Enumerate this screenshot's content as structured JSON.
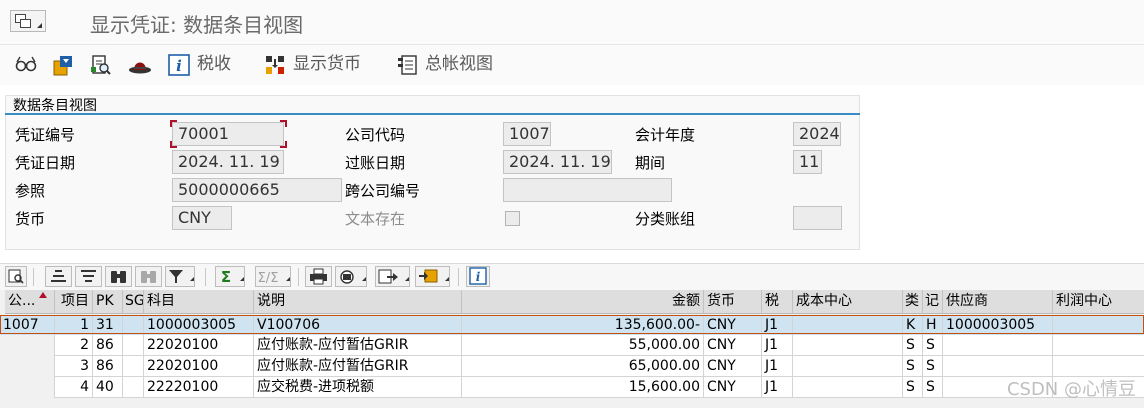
{
  "title": "显示凭证: 数据条目视图",
  "toolbar": {
    "tax_label": "税收",
    "display_currency_label": "显示货币",
    "gl_view_label": "总帐视图"
  },
  "panel": {
    "title": "数据条目视图",
    "doc_no_label": "凭证编号",
    "doc_no": "70001",
    "company_label": "公司代码",
    "company": "1007",
    "fiscal_year_label": "会计年度",
    "fiscal_year": "2024",
    "doc_date_label": "凭证日期",
    "doc_date": "2024. 11. 19",
    "posting_date_label": "过账日期",
    "posting_date": "2024. 11. 19",
    "period_label": "期间",
    "period": "11",
    "reference_label": "参照",
    "reference": "5000000665",
    "cross_company_label": "跨公司编号",
    "cross_company": "",
    "currency_label": "货币",
    "currency": "CNY",
    "text_exists_label": "文本存在",
    "ledger_group_label": "分类账组",
    "ledger_group": ""
  },
  "grid": {
    "headers": {
      "company": "公...",
      "item": "项目",
      "pk": "PK",
      "sg": "SG",
      "account": "科目",
      "desc": "说明",
      "amount": "金额",
      "currency": "货币",
      "tax": "税",
      "cost_center": "成本中心",
      "type": "类",
      "rec": "记",
      "vendor": "供应商",
      "profit_center": "利润中心"
    },
    "rows": [
      {
        "company": "1007",
        "item": "1",
        "pk": "31",
        "sg": "",
        "account": "1000003005",
        "desc": "V100706",
        "amount": "135,600.00-",
        "currency": "CNY",
        "tax": "J1",
        "cost_center": "",
        "type": "K",
        "rec": "H",
        "vendor": "1000003005",
        "profit_center": ""
      },
      {
        "company": "",
        "item": "2",
        "pk": "86",
        "sg": "",
        "account": "22020100",
        "desc": "应付账款-应付暂估GRIR",
        "amount": "55,000.00",
        "currency": "CNY",
        "tax": "J1",
        "cost_center": "",
        "type": "S",
        "rec": "S",
        "vendor": "",
        "profit_center": ""
      },
      {
        "company": "",
        "item": "3",
        "pk": "86",
        "sg": "",
        "account": "22020100",
        "desc": "应付账款-应付暂估GRIR",
        "amount": "65,000.00",
        "currency": "CNY",
        "tax": "J1",
        "cost_center": "",
        "type": "S",
        "rec": "S",
        "vendor": "",
        "profit_center": ""
      },
      {
        "company": "",
        "item": "4",
        "pk": "40",
        "sg": "",
        "account": "22220100",
        "desc": "应交税费-进项税额",
        "amount": "15,600.00",
        "currency": "CNY",
        "tax": "J1",
        "cost_center": "",
        "type": "S",
        "rec": "S",
        "vendor": "",
        "profit_center": ""
      }
    ]
  },
  "watermark": "CSDN @心情豆",
  "colors": {
    "accent": "#3a8ac4",
    "selected_row": "#cfe4f0",
    "focus_border": "#c45010"
  }
}
